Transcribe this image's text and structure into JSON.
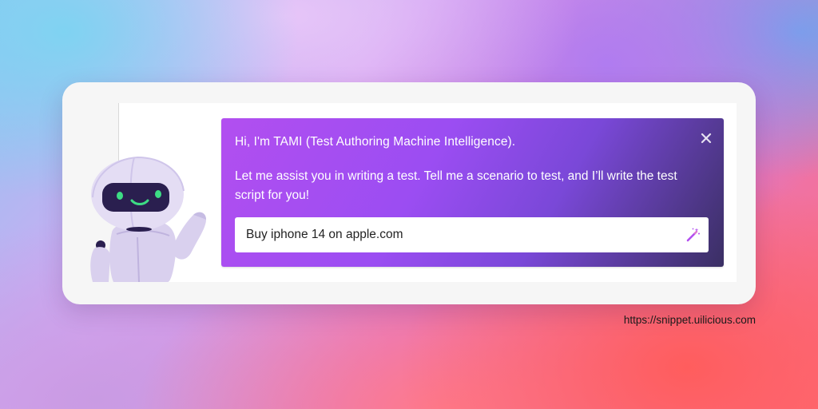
{
  "assistant": {
    "greeting": "Hi, I'm TAMI (Test Authoring Machine Intelligence).",
    "message": "Let me assist you in writing a test. Tell me a scenario to test, and I’ll write the test script for you!",
    "input": {
      "value": "Buy iphone 14 on apple.com",
      "placeholder": ""
    },
    "close_icon": "close-icon",
    "submit_icon": "magic-wand-icon"
  },
  "footer": {
    "url": "https://snippet.uilicious.com"
  },
  "colors": {
    "dialog_gradient_start": "#b24ff0",
    "dialog_gradient_end": "#3a2f63",
    "wand_icon": "#b24ff0",
    "robot_body": "#d9d0ee",
    "robot_visor": "#2a1f4f",
    "robot_eyes": "#3ddc84"
  }
}
